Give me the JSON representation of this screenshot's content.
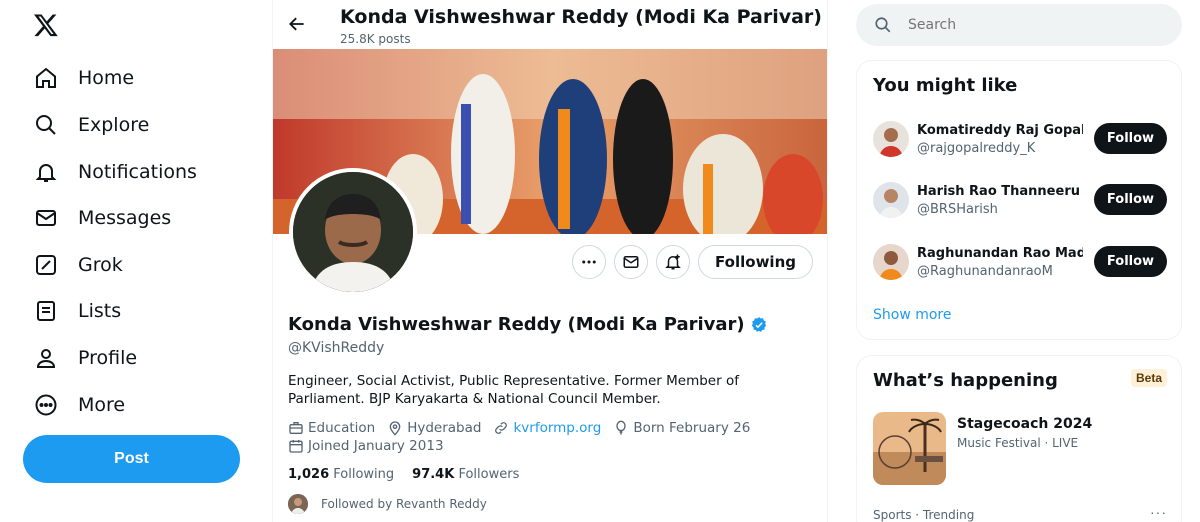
{
  "nav": {
    "items": [
      {
        "label": "Home",
        "icon": "home-icon"
      },
      {
        "label": "Explore",
        "icon": "search-icon"
      },
      {
        "label": "Notifications",
        "icon": "bell-icon"
      },
      {
        "label": "Messages",
        "icon": "mail-icon"
      },
      {
        "label": "Grok",
        "icon": "grok-icon"
      },
      {
        "label": "Lists",
        "icon": "list-icon"
      },
      {
        "label": "Profile",
        "icon": "person-icon"
      },
      {
        "label": "More",
        "icon": "more-circle-icon"
      }
    ],
    "post_label": "Post"
  },
  "header": {
    "name": "Konda Vishweshwar Reddy (Modi Ka Parivar)",
    "posts": "25.8K posts"
  },
  "profile": {
    "name": "Konda Vishweshwar Reddy (Modi Ka Parivar)",
    "handle": "@KVishReddy",
    "bio": "Engineer, Social Activist, Public Representative. Former Member of Parliament. BJP Karyakarta & National Council Member.",
    "category": "Education",
    "location": "Hyderabad",
    "website": "kvrformp.org",
    "born": "Born February 26",
    "joined": "Joined January 2013",
    "following_count": "1,026",
    "following_label": "Following",
    "followers_count": "97.4K",
    "followers_label": "Followers",
    "followed_by": "Followed by Revanth Reddy",
    "following_button": "Following"
  },
  "search": {
    "placeholder": "Search"
  },
  "suggestions": {
    "title": "You might like",
    "items": [
      {
        "name": "Komatireddy Raj Gopal Reddy",
        "handle": "@rajgopalreddy_K",
        "button": "Follow"
      },
      {
        "name": "Harish Rao Thanneeru",
        "handle": "@BRSHarish",
        "button": "Follow"
      },
      {
        "name": "Raghunandan Rao Madhavaneni",
        "handle": "@RaghunandanraoM",
        "button": "Follow"
      }
    ],
    "show_more": "Show more"
  },
  "happening": {
    "title": "What’s happening",
    "badge": "Beta",
    "trend_title": "Stagecoach 2024",
    "trend_sub": "Music Festival · LIVE",
    "trend_cat": "Sports · Trending",
    "more": "···"
  },
  "colors": {
    "accent": "#1d9bf0",
    "text": "#0f1419",
    "muted": "#536471"
  }
}
